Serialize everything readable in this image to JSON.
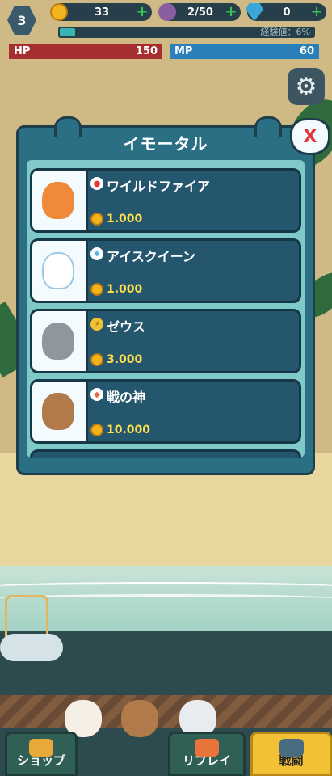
{
  "hud": {
    "level": "3",
    "gold": "33",
    "capacity": "2/50",
    "gems": "0",
    "xp_label": "経験値：6%",
    "xp_progress": 0.06,
    "hp_label": "HP",
    "hp_value": "150",
    "mp_label": "MP",
    "mp_value": "60"
  },
  "modal": {
    "title": "イモータル",
    "close_symbol": "X",
    "items": [
      {
        "name": "ワイルドファイア",
        "price": "1.000",
        "element_icon": "fire-icon",
        "element_color": "#e2363a"
      },
      {
        "name": "アイスクイーン",
        "price": "1.000",
        "element_icon": "ice-icon",
        "element_color": "#4fb6e8"
      },
      {
        "name": "ゼウス",
        "price": "3.000",
        "element_icon": "lightning-icon",
        "element_color": "#f2c136"
      },
      {
        "name": "戦の神",
        "price": "10.000",
        "element_icon": "war-icon",
        "element_color": "#e06a4a"
      }
    ]
  },
  "bottom": {
    "shop_label": "ショップ",
    "replay_label": "リプレイ",
    "fight_label": "戦闘"
  },
  "colors": {
    "modal_bg": "#2a6f83",
    "item_bg": "#24566d",
    "price": "#ffe04b",
    "hp": "#a62e2e",
    "mp": "#2b7fb8"
  }
}
